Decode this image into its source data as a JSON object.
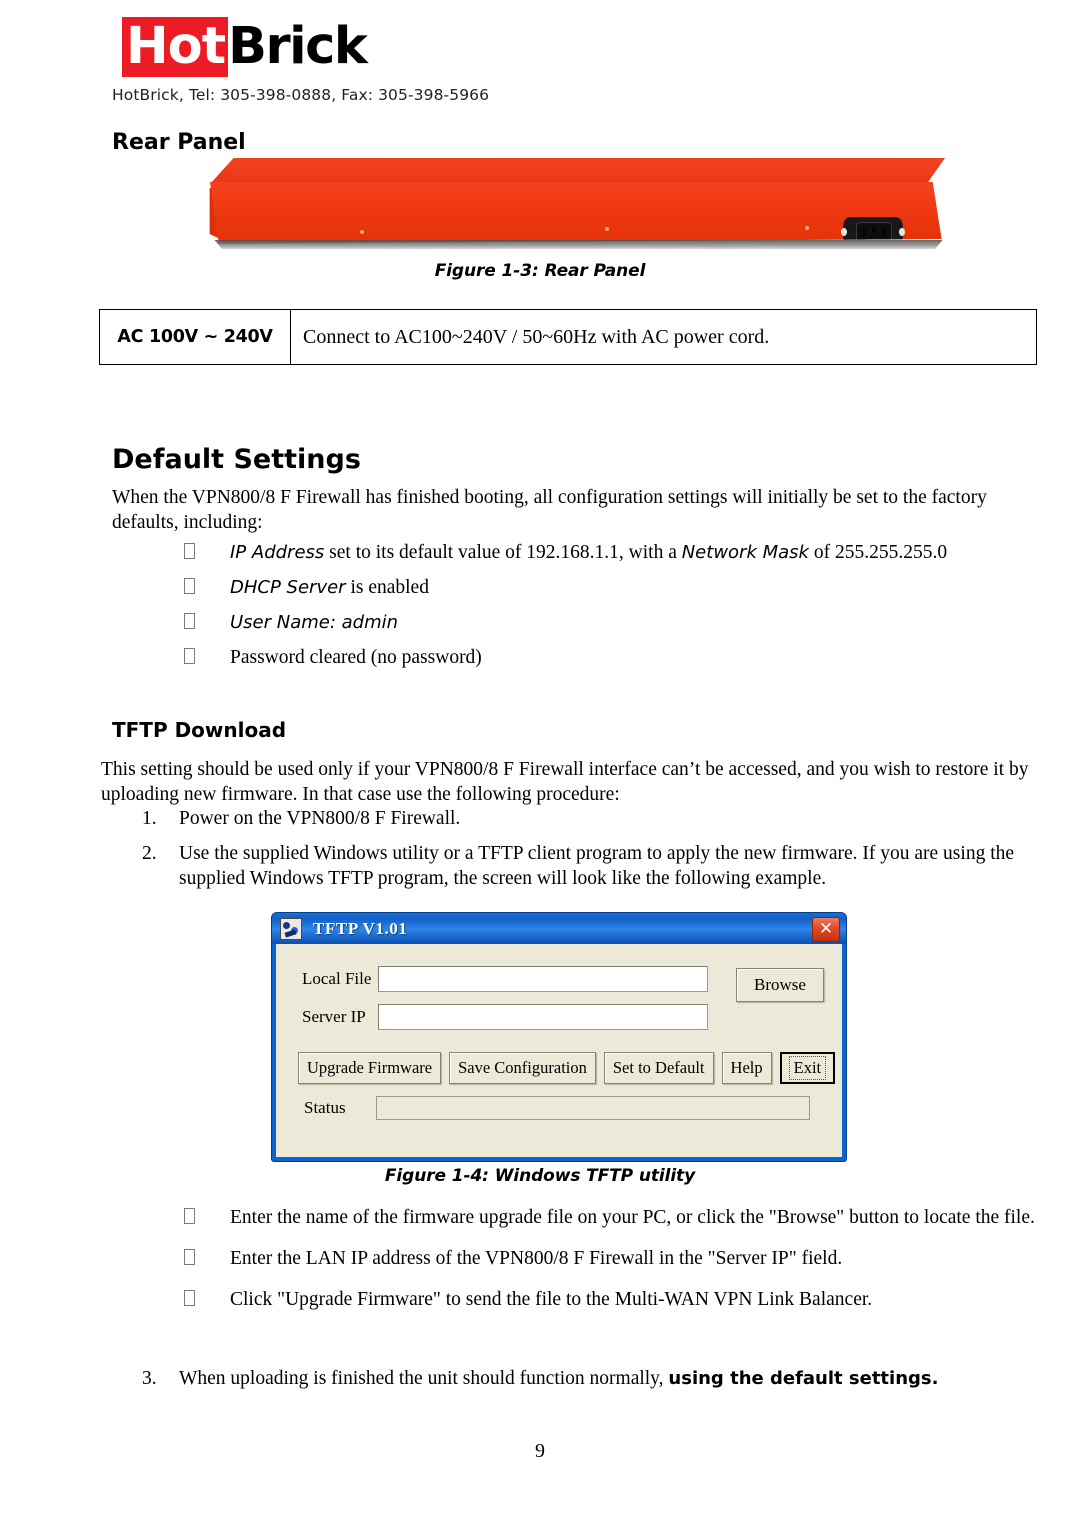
{
  "header": {
    "logo_part1": "Hot",
    "logo_part2": "Brick",
    "logo_red": "#ed1c24",
    "contact": "HotBrick, Tel: 305-398-0888, Fax: 305-398-5966"
  },
  "rear_panel": {
    "heading": "Rear Panel",
    "figure_caption": "Figure 1-3: Rear Panel",
    "device_color": "#ef3a1c",
    "spec_table": {
      "label": "AC 100V ~ 240V",
      "description": "Connect to AC100~240V / 50~60Hz with AC power cord."
    }
  },
  "default_settings": {
    "heading": "Default Settings",
    "intro": "When the VPN800/8 F Firewall has finished booting, all configuration settings will initially be set to the factory defaults, including:",
    "bullets": [
      {
        "italic_lead": "IP Address",
        "rest": " set to its default value of 192.168.1.1, with a ",
        "italic_mid": "Network Mask",
        "tail": " of 255.255.255.0"
      },
      {
        "italic_lead": "DHCP Server",
        "rest": " is enabled",
        "italic_mid": "",
        "tail": ""
      },
      {
        "italic_lead": "User Name: admin",
        "rest": "",
        "italic_mid": "",
        "tail": ""
      },
      {
        "italic_lead": "",
        "rest": "Password cleared (no password)",
        "italic_mid": "",
        "tail": ""
      }
    ]
  },
  "tftp_download": {
    "heading": "TFTP Download",
    "intro": "This setting should be used only if your VPN800/8 F Firewall interface can’t be accessed, and you wish to restore it by uploading new firmware.  In that case use the following procedure:",
    "steps": [
      {
        "num": "1.",
        "text": "Power on the VPN800/8 F Firewall.",
        "bold_tail": ""
      },
      {
        "num": "2.",
        "text": "Use the supplied Windows utility or a TFTP client program to apply the new firmware. If you are using the supplied Windows TFTP program, the screen will look like the following example.",
        "bold_tail": ""
      },
      {
        "num": "3.",
        "text": "When uploading is finished the unit should function normally, ",
        "bold_tail": "using the default settings."
      }
    ],
    "figure_caption": "Figure 1-4: Windows TFTP utility",
    "bullets": [
      "Enter the name of the firmware upgrade file on your PC, or click the \"Browse\" button to locate the file.",
      "Enter the LAN IP address of the VPN800/8 F Firewall in the \"Server IP\" field.",
      "Click \"Upgrade Firmware\" to send the file to the Multi-WAN VPN Link Balancer."
    ]
  },
  "tftp_dialog": {
    "title": "TFTP V1.01",
    "app_icon": "tftp-app-icon",
    "close_label": "✕",
    "titlebar_color": "#1a6fd4",
    "face_color": "#ece9d8",
    "fields": [
      {
        "label": "Local File",
        "value": "",
        "placeholder": ""
      },
      {
        "label": "Server IP",
        "value": "",
        "placeholder": ""
      }
    ],
    "browse_label": "Browse",
    "buttons": [
      {
        "label": "Upgrade Firmware",
        "focused": false
      },
      {
        "label": "Save Configuration",
        "focused": false
      },
      {
        "label": "Set to Default",
        "focused": false
      },
      {
        "label": "Help",
        "focused": false
      },
      {
        "label": "Exit",
        "focused": true
      }
    ],
    "status_label": "Status",
    "status_value": ""
  },
  "footer": {
    "page_number": "9"
  }
}
